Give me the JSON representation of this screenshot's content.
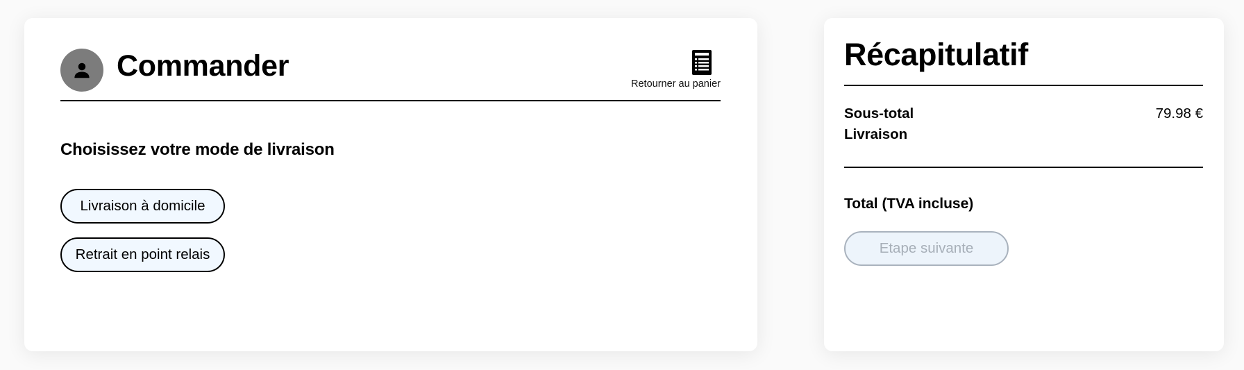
{
  "checkout": {
    "title": "Commander",
    "avatar_icon": "user-icon",
    "back_to_cart": {
      "icon": "receipt-list-icon",
      "label": "Retourner au panier"
    },
    "delivery_prompt": "Choisissez votre mode de livraison",
    "delivery_options": [
      {
        "label": "Livraison à domicile"
      },
      {
        "label": "Retrait en point relais"
      }
    ]
  },
  "summary": {
    "title": "Récapitulatif",
    "subtotal_label": "Sous-total",
    "subtotal_value": "79.98 €",
    "shipping_label": "Livraison",
    "total_label": "Total (TVA incluse)",
    "next_button": {
      "label": "Etape suivante",
      "enabled": false
    }
  },
  "colors": {
    "avatar_bg": "#7c7c7c",
    "option_bg": "#f1f8ff",
    "disabled_bg": "#edf4fb",
    "disabled_text": "#a7afb8"
  }
}
